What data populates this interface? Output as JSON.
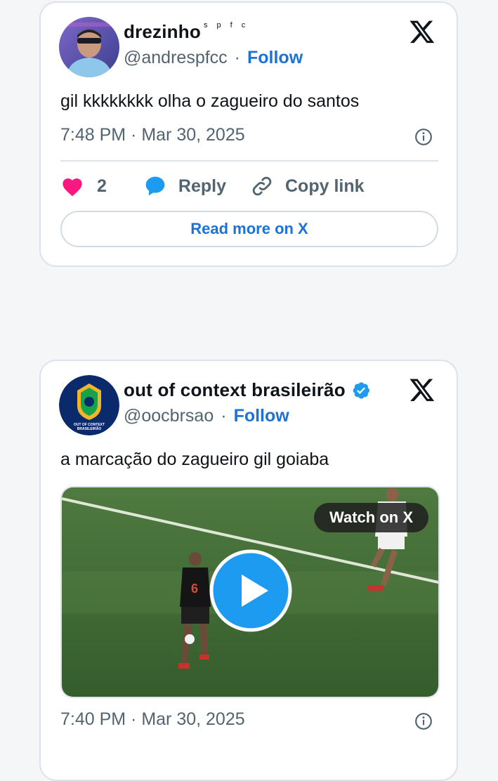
{
  "tweets": [
    {
      "display_name": "drezinho",
      "name_suffix": "s p f c",
      "handle": "@andrespfcc",
      "separator": "·",
      "follow_label": "Follow",
      "text": "gil kkkkkkkk olha o zagueiro do santos",
      "timestamp": "7:48 PM · Mar 30, 2025",
      "likes": "2",
      "reply_label": "Reply",
      "copy_label": "Copy link",
      "read_more_label": "Read more on X",
      "verified": false
    },
    {
      "display_name": "out of context brasileirão",
      "handle": "@oocbrsao",
      "separator": "·",
      "follow_label": "Follow",
      "text": "a marcação do zagueiro gil goiaba",
      "watch_label": "Watch on X",
      "timestamp": "7:40 PM · Mar 30, 2025",
      "verified": true,
      "avatar_text": "OUT OF CONTEXT BRASILEIRÃO"
    }
  ],
  "colors": {
    "accent": "#1d72d6",
    "heart": "#f91880",
    "reply_bubble": "#1d9bf0",
    "muted": "#536471",
    "border": "#dce3ea",
    "video_grass": "#3f6a34"
  },
  "icons": [
    "x-logo-icon",
    "info-icon",
    "heart-icon",
    "reply-bubble-icon",
    "link-icon",
    "play-icon",
    "verified-badge-icon"
  ]
}
